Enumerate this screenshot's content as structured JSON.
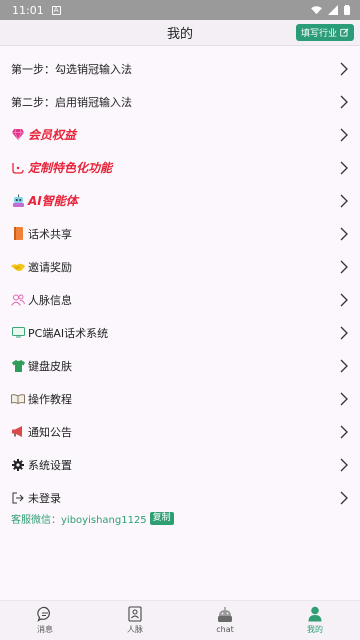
{
  "status": {
    "time": "11:01",
    "notif": "A"
  },
  "header": {
    "title": "我的",
    "fill_label": "填写行业"
  },
  "menu": [
    {
      "label": "第一步：勾选销冠输入法",
      "style": "plain",
      "icon": "none"
    },
    {
      "label": "第二步：启用销冠输入法",
      "style": "plain",
      "icon": "none"
    },
    {
      "label": "会员权益",
      "style": "red",
      "icon": "diamond-icon"
    },
    {
      "label": "定制特色化功能",
      "style": "red",
      "icon": "custom-icon"
    },
    {
      "label": "AI智能体",
      "style": "red",
      "icon": "robot-icon"
    },
    {
      "label": "话术共享",
      "style": "plain",
      "icon": "book-icon"
    },
    {
      "label": "邀请奖励",
      "style": "plain",
      "icon": "handshake-icon"
    },
    {
      "label": "人脉信息",
      "style": "plain",
      "icon": "people-icon"
    },
    {
      "label": "PC端AI话术系统",
      "style": "plain",
      "icon": "monitor-icon"
    },
    {
      "label": "键盘皮肤",
      "style": "plain",
      "icon": "shirt-icon"
    },
    {
      "label": "操作教程",
      "style": "plain",
      "icon": "open-book-icon"
    },
    {
      "label": "通知公告",
      "style": "plain",
      "icon": "megaphone-icon"
    },
    {
      "label": "系统设置",
      "style": "plain",
      "icon": "gear-icon"
    },
    {
      "label": "未登录",
      "style": "plain",
      "icon": "login-icon"
    }
  ],
  "customer_service": {
    "text": "客服微信：yiboyishang1125",
    "copy_label": "复制"
  },
  "tabs": [
    {
      "label": "消息",
      "icon": "message-icon",
      "active": false
    },
    {
      "label": "人脉",
      "icon": "contacts-icon",
      "active": false
    },
    {
      "label": "chat",
      "icon": "chat-bot-icon",
      "active": false
    },
    {
      "label": "我的",
      "icon": "user-icon",
      "active": true
    }
  ],
  "colors": {
    "accent": "#2f9e73",
    "red_label": "#e8243a",
    "background": "#fbf7fc"
  }
}
